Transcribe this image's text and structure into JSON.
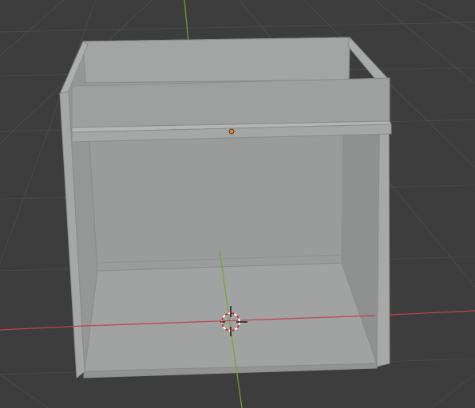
{
  "viewport": {
    "background_color": "#3d3d3d",
    "grid_color": "#4a4a4a",
    "x_axis_color": "#c0434f",
    "y_axis_color": "#7aa22f",
    "mesh_base_color": "#a0a1a1",
    "mesh_edge_color": "#8a8b8b",
    "origin_color": "#e8842c",
    "cursor_icon": "3d-cursor-icon",
    "origin_icon": "object-origin-icon"
  }
}
